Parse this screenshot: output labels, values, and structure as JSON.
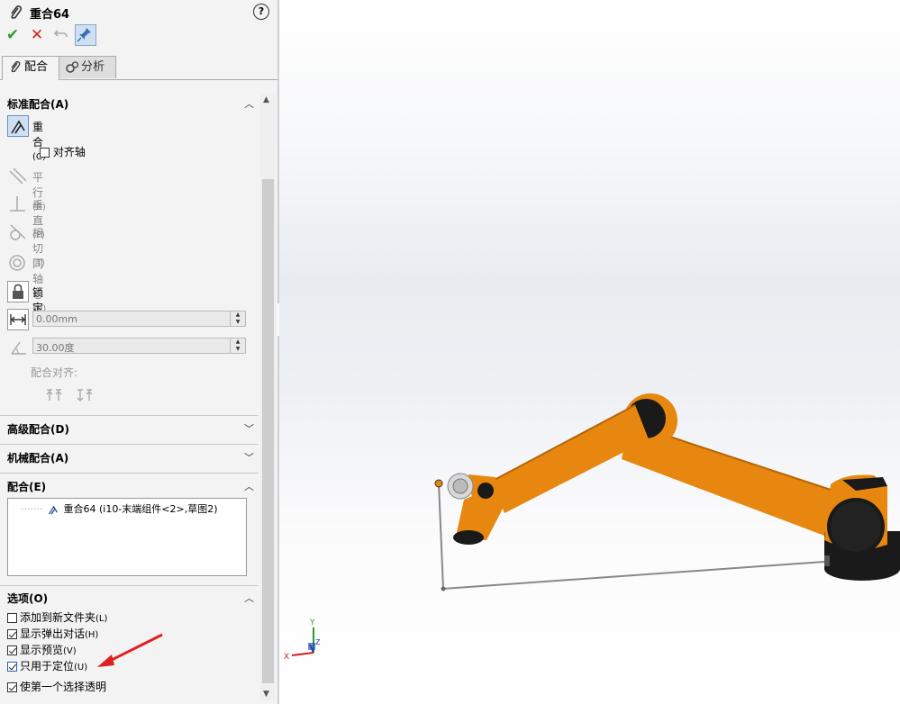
{
  "property_manager": {
    "title": "重合64",
    "help_glyph": "?",
    "actions": {
      "ok": "✔",
      "cancel": "✕"
    },
    "tabs": [
      {
        "label": "配合",
        "active": true
      },
      {
        "label": "分析",
        "active": false
      }
    ]
  },
  "standard_mates": {
    "heading": "标准配合(A)",
    "items": {
      "coincident": {
        "label": "重合",
        "key": "(C)",
        "selected": true
      },
      "align_axis": {
        "label": "对齐轴",
        "checked": false
      },
      "parallel": {
        "label": "平行",
        "key": "(R)"
      },
      "perpendicular": {
        "label": "垂直",
        "key": "(P)"
      },
      "tangent": {
        "label": "相切",
        "key": "(T)"
      },
      "concentric": {
        "label": "同轴心",
        "key": "(N)"
      },
      "lock": {
        "label": "锁定",
        "key": "(O)"
      }
    },
    "distance_value": "0.00mm",
    "angle_value": "30.00度",
    "mate_alignment_label": "配合对齐:"
  },
  "advanced_mates": {
    "heading": "高级配合(D)"
  },
  "mechanical_mates": {
    "heading": "机械配合(A)"
  },
  "mates_section": {
    "heading": "配合(E)",
    "entries": [
      "重合64 (i10-末端组件<2>,草图2)"
    ]
  },
  "options": {
    "heading": "选项(O)",
    "items": [
      {
        "label": "添加到新文件夹",
        "key": "(L)",
        "checked": false
      },
      {
        "label": "显示弹出对话",
        "key": "(H)",
        "checked": true
      },
      {
        "label": "显示预览",
        "key": "(V)",
        "checked": true
      },
      {
        "label": "只用于定位",
        "key": "(U)",
        "checked": true
      },
      {
        "label": "使第一个选择透明",
        "key": "",
        "checked": true
      }
    ]
  },
  "triad": {
    "x_label": "X",
    "y_label": "Y",
    "z_label": "Z"
  },
  "colors": {
    "robot_orange": "#e8870f",
    "robot_black": "#1a1a1a",
    "selection_blue": "#cfe0f5",
    "arrow_red": "#e02020",
    "ok_green": "#2aa02a",
    "cancel_red": "#d42020"
  }
}
